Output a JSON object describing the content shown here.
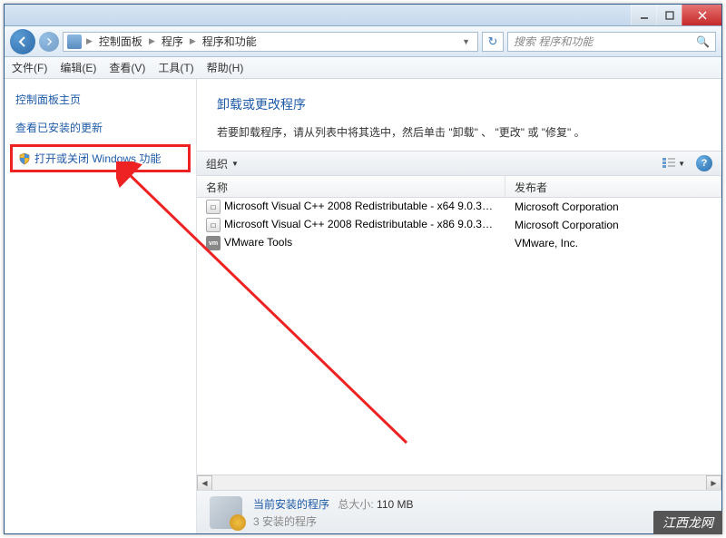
{
  "titlebar": {},
  "nav": {
    "breadcrumb": [
      "控制面板",
      "程序",
      "程序和功能"
    ],
    "search_placeholder": "搜索 程序和功能"
  },
  "menubar": [
    "文件(F)",
    "编辑(E)",
    "查看(V)",
    "工具(T)",
    "帮助(H)"
  ],
  "sidebar": {
    "title": "控制面板主页",
    "links": [
      {
        "label": "查看已安装的更新",
        "highlight": false,
        "shield": false
      },
      {
        "label": "打开或关闭 Windows 功能",
        "highlight": true,
        "shield": true
      }
    ]
  },
  "main": {
    "title": "卸载或更改程序",
    "desc": "若要卸载程序，请从列表中将其选中，然后单击 \"卸载\" 、 \"更改\" 或 \"修复\" 。"
  },
  "toolbar": {
    "organize": "组织"
  },
  "columns": {
    "name": "名称",
    "publisher": "发布者"
  },
  "rows": [
    {
      "icon": "vc",
      "name": "Microsoft Visual C++ 2008 Redistributable - x64 9.0.30...",
      "publisher": "Microsoft Corporation"
    },
    {
      "icon": "vc",
      "name": "Microsoft Visual C++ 2008 Redistributable - x86 9.0.30...",
      "publisher": "Microsoft Corporation"
    },
    {
      "icon": "vm",
      "name": "VMware Tools",
      "publisher": "VMware, Inc."
    }
  ],
  "status": {
    "title": "当前安装的程序",
    "size_label": "总大小:",
    "size_value": "110 MB",
    "count": "3 安装的程序"
  },
  "watermark": "江西龙网"
}
